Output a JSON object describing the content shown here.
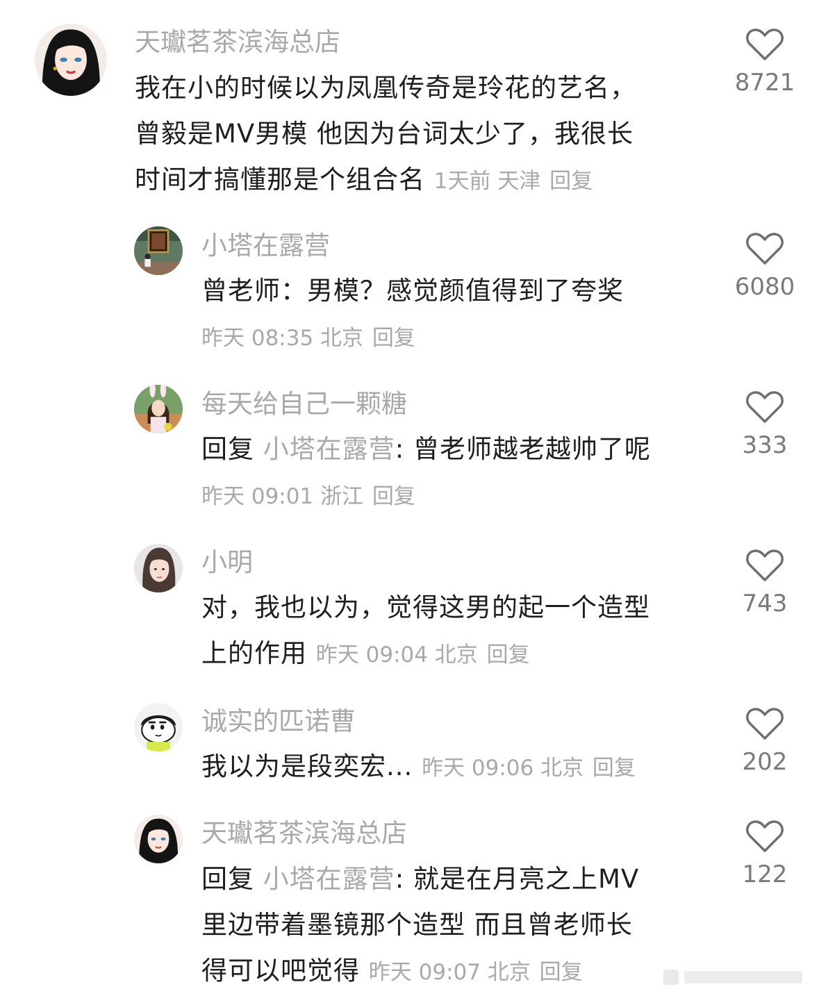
{
  "comments": [
    {
      "username": "天瓛茗茶滨海总店",
      "lines": [
        "我在小的时候以为凤凰传奇是玲花的艺名，",
        "曾毅是MV男模 他因为台词太少了，我很长",
        "时间才搞懂那是个组合名"
      ],
      "meta": "1天前 天津",
      "reply": "回复",
      "likes": "8721",
      "avatar": "anime-woman-avatar"
    },
    {
      "username": "小塔在露营",
      "lines": [
        "曾老师：男模？感觉颜值得到了夸奖"
      ],
      "meta": "昨天 08:35 北京",
      "reply": "回复",
      "likes": "6080",
      "avatar": "museum-photo-avatar"
    },
    {
      "username": "每天给自己一颗糖",
      "prefix": "回复",
      "mention": "小塔在露营",
      "lines": [
        ": 曾老师越老越帅了呢"
      ],
      "meta": "昨天 09:01 浙江",
      "reply": "回复",
      "likes": "333",
      "avatar": "bunny-ears-girl-avatar"
    },
    {
      "username": "小明",
      "lines": [
        "对，我也以为，觉得这男的起一个造型",
        "上的作用"
      ],
      "meta": "昨天 09:04 北京",
      "reply": "回复",
      "likes": "743",
      "avatar": "woman-portrait-avatar"
    },
    {
      "username": "诚实的匹诺曹",
      "lines": [
        "我以为是段奕宏..."
      ],
      "meta": "昨天 09:06 北京",
      "reply": "回复",
      "likes": "202",
      "avatar": "cartoon-boy-avatar"
    },
    {
      "username": "天瓛茗茶滨海总店",
      "prefix": "回复",
      "mention": "小塔在露营",
      "lines": [
        ": 就是在月亮之上MV",
        "里边带着墨镜那个造型 而且曾老师长",
        "得可以吧觉得"
      ],
      "meta": "昨天 09:07 北京",
      "reply": "回复",
      "likes": "122",
      "avatar": "anime-woman-avatar"
    }
  ]
}
